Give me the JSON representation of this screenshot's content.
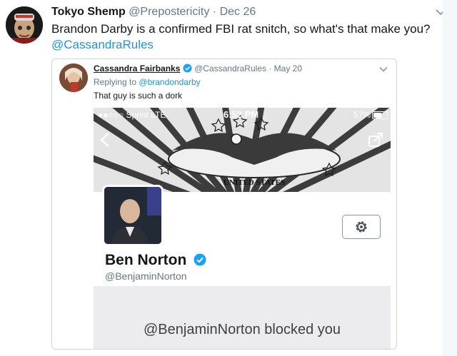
{
  "tweet": {
    "name": "Tokyo Shemp",
    "handle": "@Prepostericity",
    "separator": "·",
    "date": "Dec 26",
    "text": "Brandon Darby is a confirmed FBI rat snitch, so what's that make you?",
    "mention": "@CassandraRules",
    "menu_icon": "chevron-down-icon"
  },
  "quote": {
    "name": "Cassandra Fairbanks",
    "handle": "@CassandraRules",
    "separator": "·",
    "date": "May 20",
    "reply_prefix": "Replying to",
    "reply_to": "@brandondarby",
    "text": "That guy is such a dork",
    "menu_icon": "chevron-down-icon"
  },
  "screenshot": {
    "carrier": "●●○○○ Sprint  LTE",
    "time": "6:52 PM",
    "battery": "57%",
    "profile_name": "Ben Norton",
    "profile_handle": "@BenjaminNorton",
    "blocked_message": "@BenjaminNorton blocked you",
    "banner_text": "UNITED STATES"
  },
  "colors": {
    "link": "#1b95e0",
    "verified": "#1da1f2",
    "muted": "#657786"
  }
}
